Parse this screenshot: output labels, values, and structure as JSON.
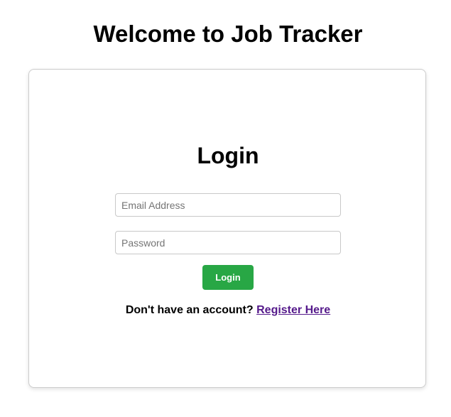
{
  "header": {
    "title": "Welcome to Job Tracker"
  },
  "login_form": {
    "heading": "Login",
    "email_placeholder": "Email Address",
    "password_placeholder": "Password",
    "submit_label": "Login",
    "register_prompt": "Don't have an account?",
    "register_link": "Register Here"
  },
  "colors": {
    "login_button": "#28a745",
    "link_visited": "#551a8b",
    "card_border": "#cccccc"
  }
}
